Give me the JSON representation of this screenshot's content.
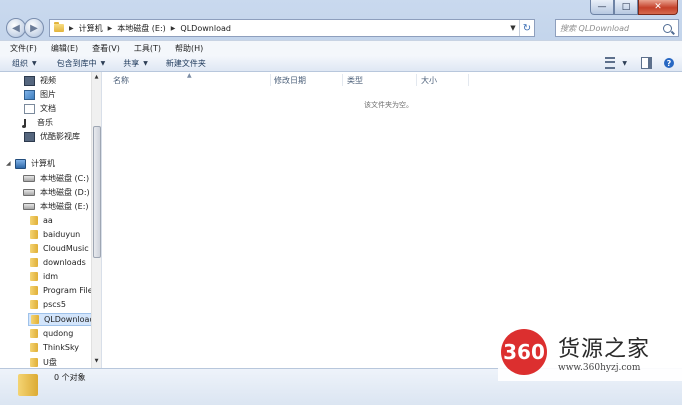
{
  "window": {
    "caption_buttons": [
      "—",
      "□",
      "✕"
    ]
  },
  "address_bar": {
    "breadcrumbs": [
      "计算机",
      "本地磁盘 (E:)",
      "QLDownload"
    ]
  },
  "search": {
    "placeholder": "搜索 QLDownload"
  },
  "menubar": {
    "items": [
      "文件(F)",
      "编辑(E)",
      "查看(V)",
      "工具(T)",
      "帮助(H)"
    ]
  },
  "toolbar": {
    "organize": "组织",
    "include_in_library": "包含到库中",
    "share": "共享",
    "new_folder": "新建文件夹"
  },
  "navigation": {
    "libraries": [
      "视频",
      "图片",
      "文档",
      "音乐",
      "优酷影视库"
    ],
    "computer": "计算机",
    "drives": [
      "本地磁盘 (C:)",
      "本地磁盘 (D:)",
      "本地磁盘 (E:)"
    ],
    "folders": [
      "aa",
      "baiduyun",
      "CloudMusic",
      "downloads",
      "idm",
      "Program Files",
      "pscs5",
      "QLDownload",
      "qudong",
      "ThinkSky",
      "U盘"
    ]
  },
  "columns": {
    "name": "名称",
    "modified": "修改日期",
    "type": "类型",
    "size": "大小"
  },
  "content": {
    "empty_message": "该文件夹为空。"
  },
  "status": {
    "item_count": "0 个对象"
  },
  "watermark": {
    "badge": "360",
    "brand": "货源之家",
    "url": "www.360hyzj.com"
  }
}
